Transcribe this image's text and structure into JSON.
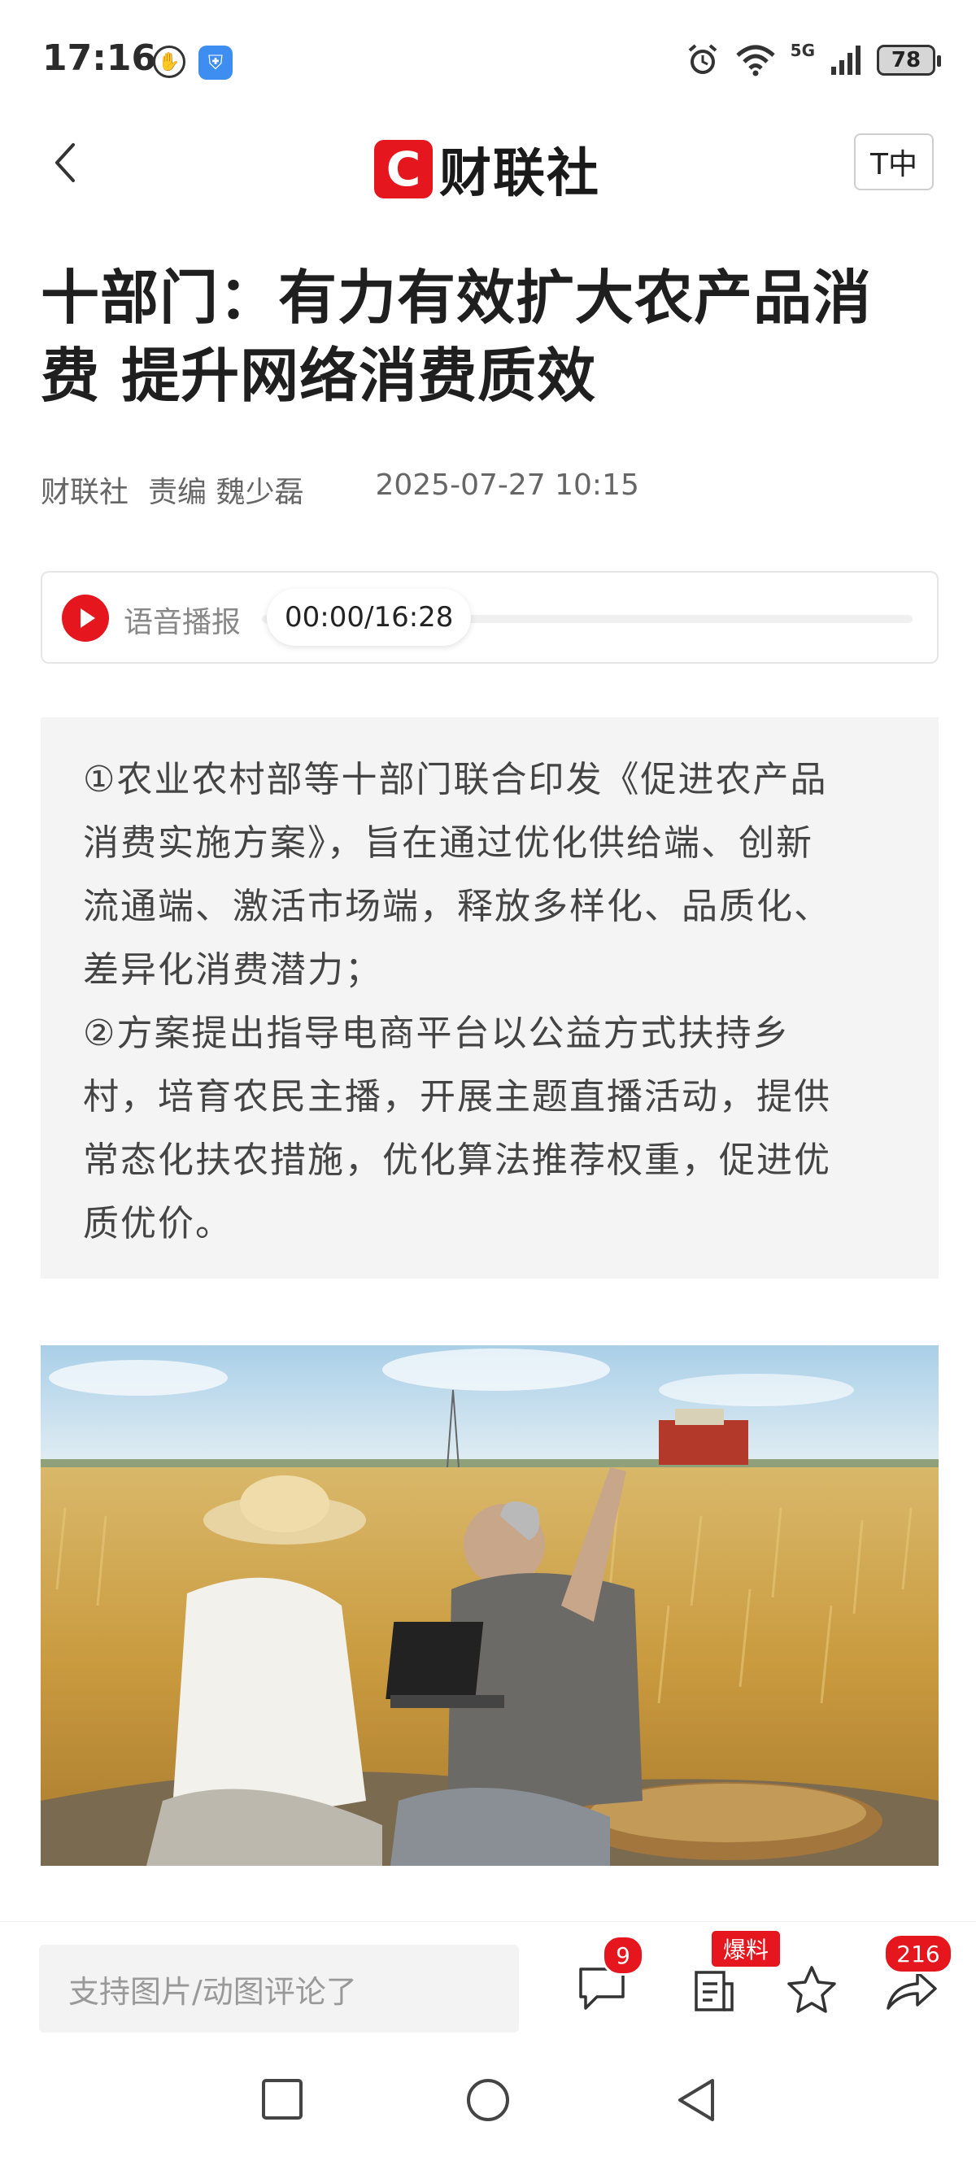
{
  "status_bar": {
    "time": "17:16",
    "battery": "78",
    "network": "5G",
    "icons": [
      "hand-icon",
      "app-shield-icon",
      "alarm-icon",
      "wifi-icon",
      "signal-icon",
      "battery-icon"
    ]
  },
  "header": {
    "logo_mark": "C",
    "logo_text": "财联社",
    "font_size_label": "T中",
    "brand_color": "#e5161d"
  },
  "article": {
    "title_line1": "十部门：有力有效扩大农产品消",
    "title_line2": "费 提升网络消费质效",
    "source": "财联社",
    "editor": "责编 魏少磊",
    "datetime": "2025-07-27 10:15"
  },
  "audio": {
    "label": "语音播报",
    "time": "00:00/16:28",
    "progress": 0
  },
  "summary": {
    "lines": [
      "①农业农村部等十部门联合印发《促进农产品",
      "消费实施方案》，旨在通过优化供给端、创新",
      "流通端、激活市场端，释放多样化、品质化、",
      "差异化消费潜力；",
      "②方案提出指导电商平台以公益方式扶持乡",
      "村，培育农民主播，开展主题直播活动，提供",
      "常态化扶农措施，优化算法推荐权重，促进优",
      "质优价。"
    ]
  },
  "bottom_bar": {
    "comment_placeholder": "支持图片/动图评论了",
    "comment_count": "9",
    "report_badge": "爆料",
    "share_count": "216"
  }
}
